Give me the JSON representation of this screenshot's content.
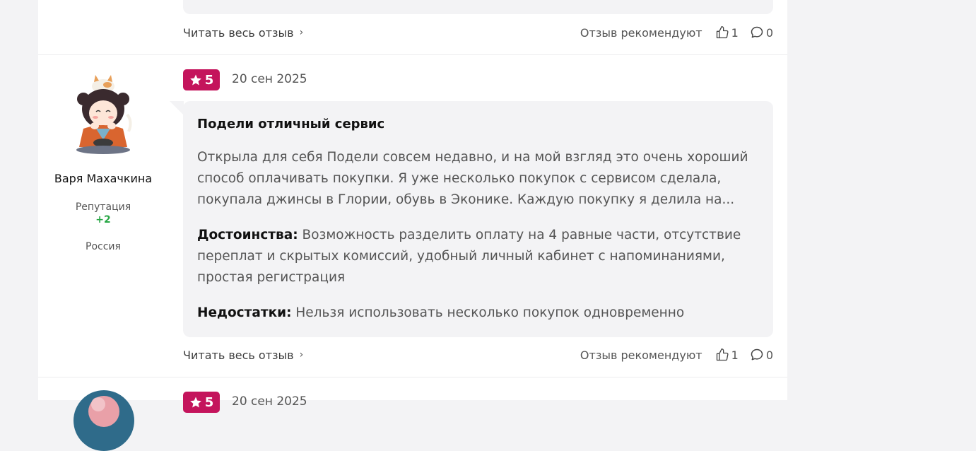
{
  "prev_review": {
    "read_full": "Читать весь отзыв",
    "recommend": "Отзыв рекомендуют",
    "likes": "1",
    "comments": "0"
  },
  "review": {
    "rating": "5",
    "date": "20 сен 2025",
    "author": {
      "name": "Варя Махачкина",
      "reputation_label": "Репутация",
      "reputation_value": "+2",
      "country": "Россия"
    },
    "title": "Подели отличный сервис",
    "body": "Открыла для себя Подели совсем недавно, и на мой взгляд это очень хороший способ оплачивать покупки. Я уже несколько покупок с сервисом сделала, покупала джинсы в Глории, обувь в Эконике. Каждую покупку я делила на...",
    "pros_label": "Достоинства:",
    "pros": "Возможность разделить оплату на 4 равные части, отсутствие переплат и скрытых комиссий, удобный личный кабинет с напоминаниями, простая регистрация",
    "cons_label": "Недостатки:",
    "cons": "Нельзя использовать несколько покупок одновременно",
    "read_full": "Читать весь отзыв",
    "recommend": "Отзыв рекомендуют",
    "likes": "1",
    "comments": "0"
  },
  "next_review": {
    "rating": "5",
    "date": "20 сен 2025"
  },
  "colors": {
    "accent": "#c4145c",
    "reputation": "#28a745",
    "card_bg": "#f3f3f5"
  }
}
